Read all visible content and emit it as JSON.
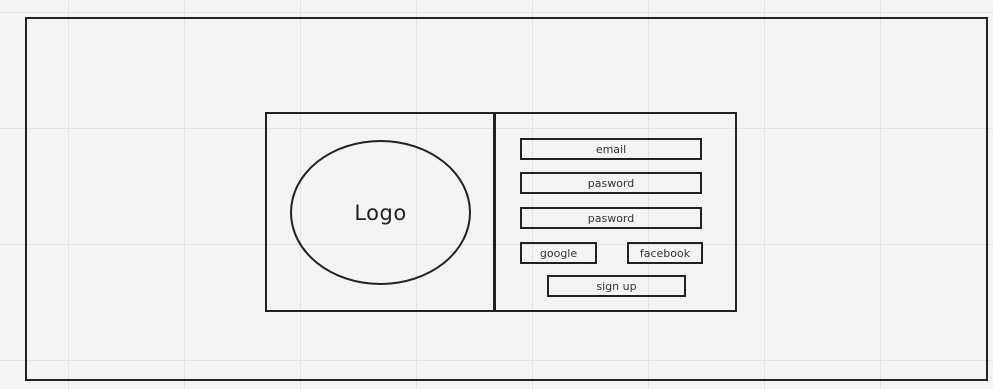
{
  "logo": {
    "label": "Logo"
  },
  "form": {
    "email_label": "email",
    "password_label": "pasword",
    "confirm_password_label": "pasword",
    "google_label": "google",
    "facebook_label": "facebook",
    "signup_label": "sign up"
  }
}
